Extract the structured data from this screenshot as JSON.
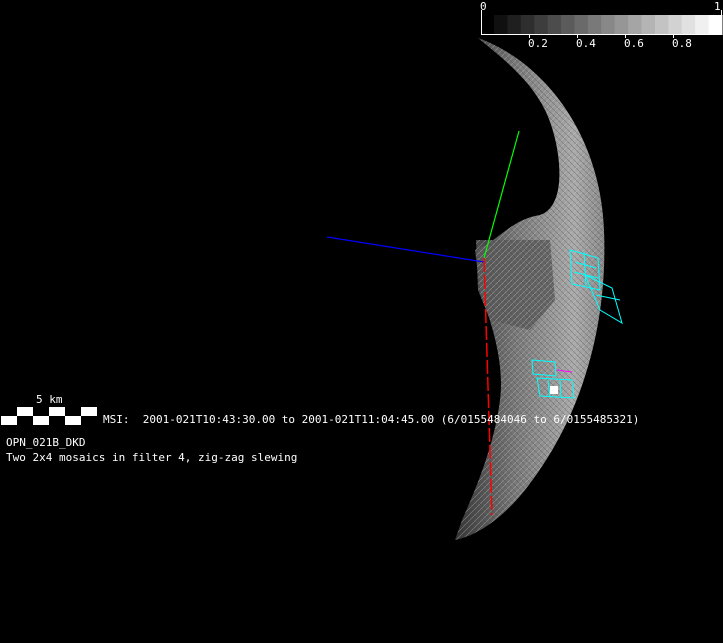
{
  "colorbar": {
    "min_label": "0",
    "max_label": "1",
    "tick_labels": [
      "0.2",
      "0.4",
      "0.6",
      "0.8"
    ],
    "steps": 17
  },
  "scale_bar": {
    "label": "5 km"
  },
  "msi_line": "MSI:  2001-021T10:43:30.00 to 2001-021T11:04:45.00 (6/0155484046 to 6/0155485321)",
  "observation_id": "OPN_021B_DKD",
  "description": "Two 2x4 mosaics in filter 4, zig-zag slewing",
  "colors": {
    "x_axis": "#ff0000",
    "y_axis": "#00ff00",
    "z_axis": "#0000ff",
    "footprint": "#00ffff",
    "highlight": "#ff00ff"
  }
}
